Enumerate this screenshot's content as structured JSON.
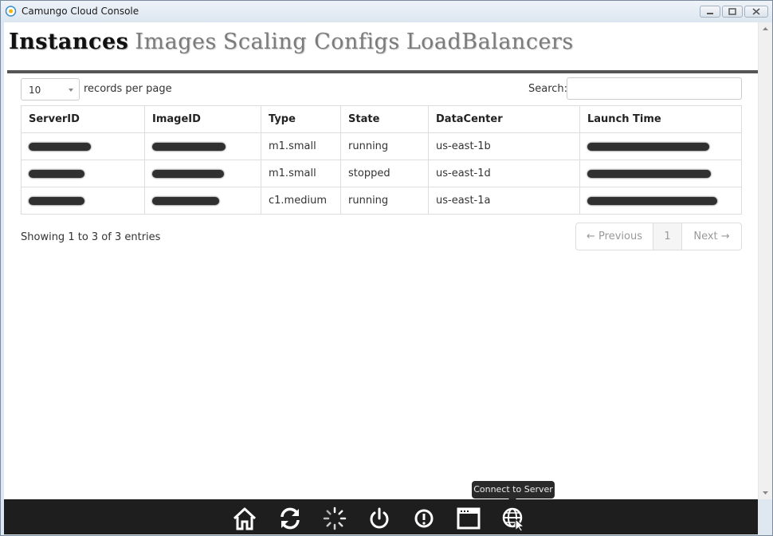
{
  "window": {
    "title": "Camungo Cloud Console"
  },
  "tabs": [
    {
      "label": "Instances",
      "active": true
    },
    {
      "label": "Images",
      "active": false
    },
    {
      "label": "Scaling Configs",
      "active": false
    },
    {
      "label": "LoadBalancers",
      "active": false
    }
  ],
  "controls": {
    "page_length": "10",
    "page_length_label": "records per page",
    "search_label": "Search:",
    "search_value": ""
  },
  "table": {
    "columns": [
      "ServerID",
      "ImageID",
      "Type",
      "State",
      "DataCenter",
      "Launch Time"
    ],
    "rows": [
      {
        "server_id": "[redacted]",
        "image_id": "[redacted]",
        "type": "m1.small",
        "state": "running",
        "datacenter": "us-east-1b",
        "launch_time": "[redacted]"
      },
      {
        "server_id": "[redacted]",
        "image_id": "[redacted]",
        "type": "m1.small",
        "state": "stopped",
        "datacenter": "us-east-1d",
        "launch_time": "[redacted]"
      },
      {
        "server_id": "[redacted]",
        "image_id": "[redacted]",
        "type": "c1.medium",
        "state": "running",
        "datacenter": "us-east-1a",
        "launch_time": "[redacted]"
      }
    ]
  },
  "info": "Showing 1 to 3 of 3 entries",
  "pagination": {
    "previous": "← Previous",
    "page": "1",
    "next": "Next →"
  },
  "taskbar": {
    "icons": [
      "home-icon",
      "refresh-icon",
      "loading-spinner-icon",
      "power-icon",
      "info-icon",
      "window-icon",
      "connect-globe-icon"
    ],
    "tooltip": "Connect to Server"
  },
  "colors": {
    "taskbar": "#1e1e1e",
    "tab_rule": "#555555",
    "active_tab": "#111111",
    "inactive_tab": "#7b7b7b"
  }
}
